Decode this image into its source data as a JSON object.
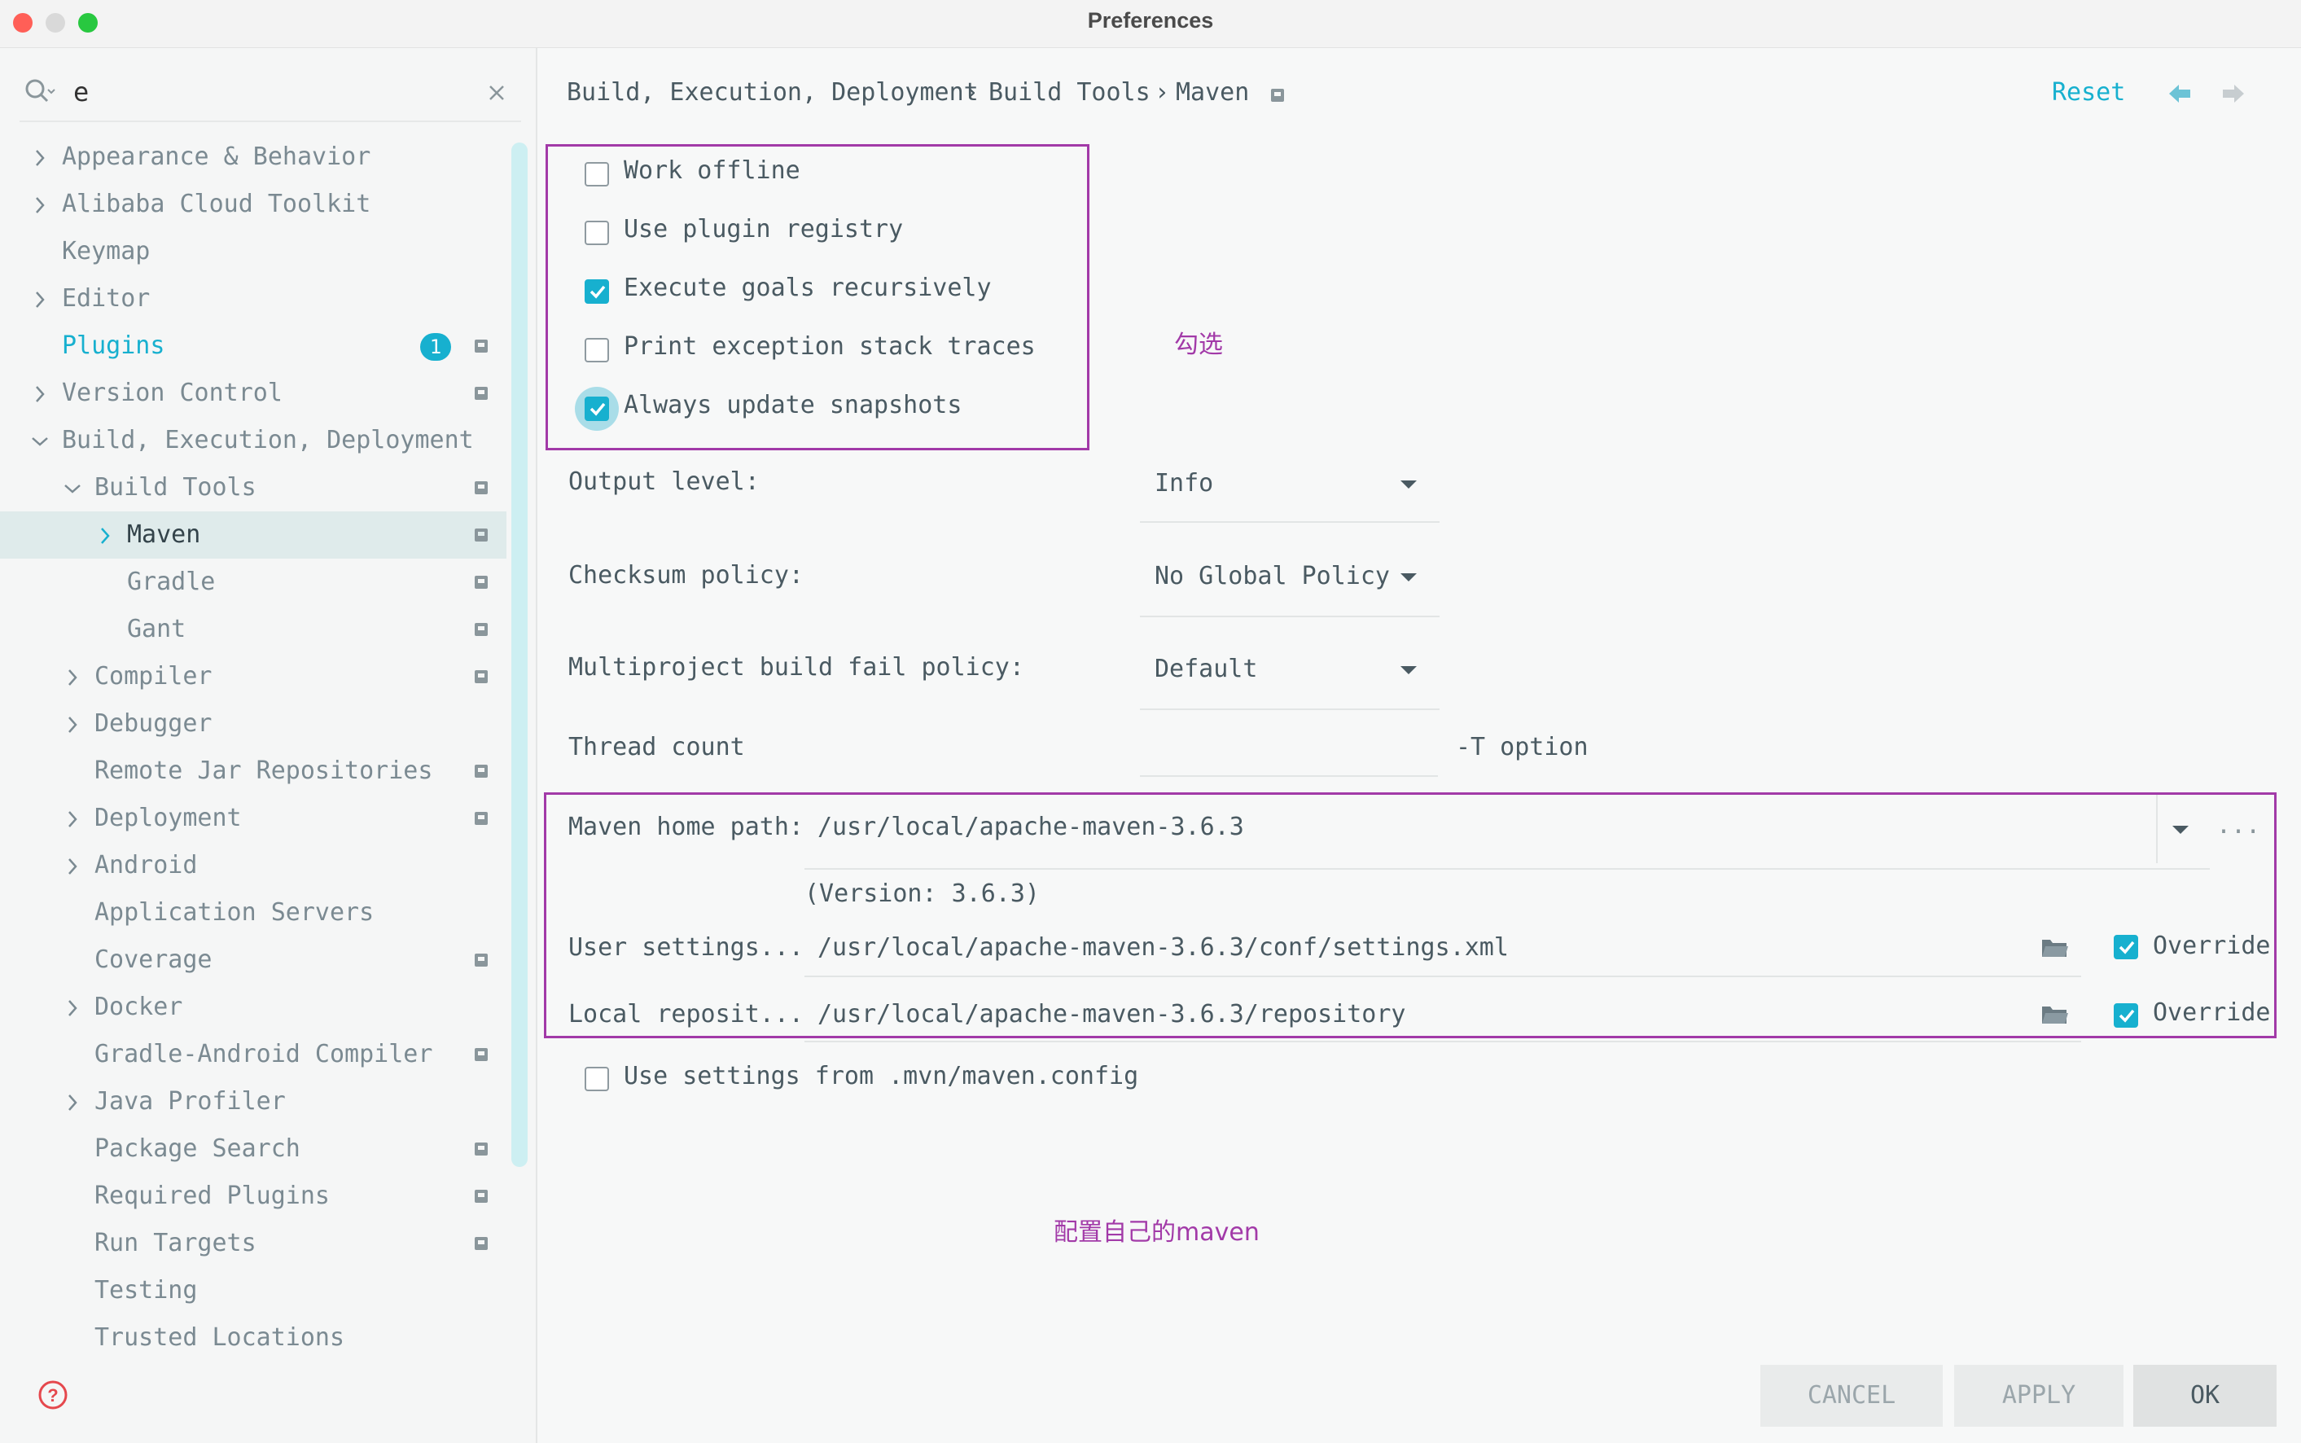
{
  "window": {
    "title": "Preferences"
  },
  "sidebar": {
    "search_value": "e",
    "items": [
      {
        "label": "Appearance & Behavior"
      },
      {
        "label": "Alibaba Cloud Toolkit"
      },
      {
        "label": "Keymap"
      },
      {
        "label": "Editor"
      },
      {
        "label": "Plugins",
        "badge": "1"
      },
      {
        "label": "Version Control"
      },
      {
        "label": "Build, Execution, Deployment"
      },
      {
        "label": "Build Tools"
      },
      {
        "label": "Maven"
      },
      {
        "label": "Gradle"
      },
      {
        "label": "Gant"
      },
      {
        "label": "Compiler"
      },
      {
        "label": "Debugger"
      },
      {
        "label": "Remote Jar Repositories"
      },
      {
        "label": "Deployment"
      },
      {
        "label": "Android"
      },
      {
        "label": "Application Servers"
      },
      {
        "label": "Coverage"
      },
      {
        "label": "Docker"
      },
      {
        "label": "Gradle-Android Compiler"
      },
      {
        "label": "Java Profiler"
      },
      {
        "label": "Package Search"
      },
      {
        "label": "Required Plugins"
      },
      {
        "label": "Run Targets"
      },
      {
        "label": "Testing"
      },
      {
        "label": "Trusted Locations"
      }
    ]
  },
  "breadcrumb": {
    "part1": "Build, Execution, Deployment",
    "part2": "Build Tools",
    "part3": "Maven"
  },
  "header": {
    "reset_label": "Reset"
  },
  "options": {
    "work_offline": {
      "label": "Work offline",
      "checked": false
    },
    "use_plugin_registry": {
      "label": "Use plugin registry",
      "checked": false
    },
    "execute_goals": {
      "label": "Execute goals recursively",
      "checked": true
    },
    "print_exception": {
      "label": "Print exception stack traces",
      "checked": false
    },
    "always_update": {
      "label": "Always update snapshots",
      "checked": true
    }
  },
  "annotations": {
    "check_note": "勾选",
    "maven_note": "配置自己的maven"
  },
  "fields": {
    "output_level": {
      "label": "Output level:",
      "value": "Info"
    },
    "checksum_policy": {
      "label": "Checksum policy:",
      "value": "No Global Policy"
    },
    "fail_policy": {
      "label": "Multiproject build fail policy:",
      "value": "Default"
    },
    "thread_count": {
      "label": "Thread count",
      "value": "",
      "suffix": "-T option"
    },
    "maven_home": {
      "label": "Maven home path:",
      "value": "/usr/local/apache-maven-3.6.3",
      "version": "(Version: 3.6.3)",
      "more": "..."
    },
    "user_settings": {
      "label": "User settings...",
      "value": "/usr/local/apache-maven-3.6.3/conf/settings.xml",
      "override_label": "Override",
      "override": true
    },
    "local_repo": {
      "label": "Local reposit...",
      "value": "/usr/local/apache-maven-3.6.3/repository",
      "override_label": "Override",
      "override": true
    },
    "use_mvn_config": {
      "label": "Use settings from .mvn/maven.config",
      "checked": false
    }
  },
  "buttons": {
    "cancel": "CANCEL",
    "apply": "APPLY",
    "ok": "OK"
  },
  "colors": {
    "accent": "#17b0cf",
    "annotation": "#a23aa8",
    "help": "#e5484d"
  }
}
